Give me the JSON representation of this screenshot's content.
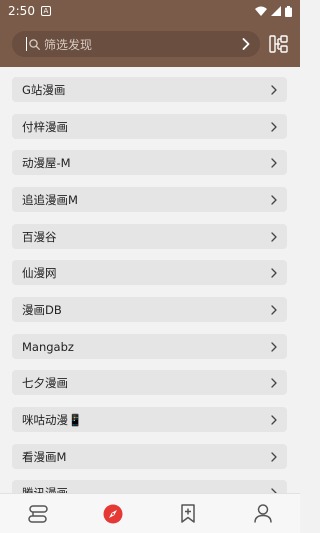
{
  "status_bar": {
    "time": "2:50",
    "notification_letter": "A"
  },
  "search": {
    "placeholder": "筛选发现"
  },
  "sources": [
    {
      "label": "G站漫画"
    },
    {
      "label": "付梓漫画"
    },
    {
      "label": "动漫屋-M"
    },
    {
      "label": "追追漫画M"
    },
    {
      "label": "百漫谷"
    },
    {
      "label": "仙漫网"
    },
    {
      "label": "漫画DB"
    },
    {
      "label": "Mangabz"
    },
    {
      "label": "七夕漫画"
    },
    {
      "label": "咪咕动漫📱"
    },
    {
      "label": "看漫画M"
    },
    {
      "label": "腾讯漫画"
    }
  ],
  "bottom_nav": {
    "items": [
      {
        "icon": "bookshelf-icon",
        "active": false
      },
      {
        "icon": "compass-icon",
        "active": true
      },
      {
        "icon": "bookmark-add-icon",
        "active": false
      },
      {
        "icon": "person-icon",
        "active": false
      }
    ]
  },
  "colors": {
    "header": "#7a5a48",
    "search_bg": "#6a4e3f",
    "item_bg": "#e5e5e5",
    "active_accent": "#e53935"
  }
}
